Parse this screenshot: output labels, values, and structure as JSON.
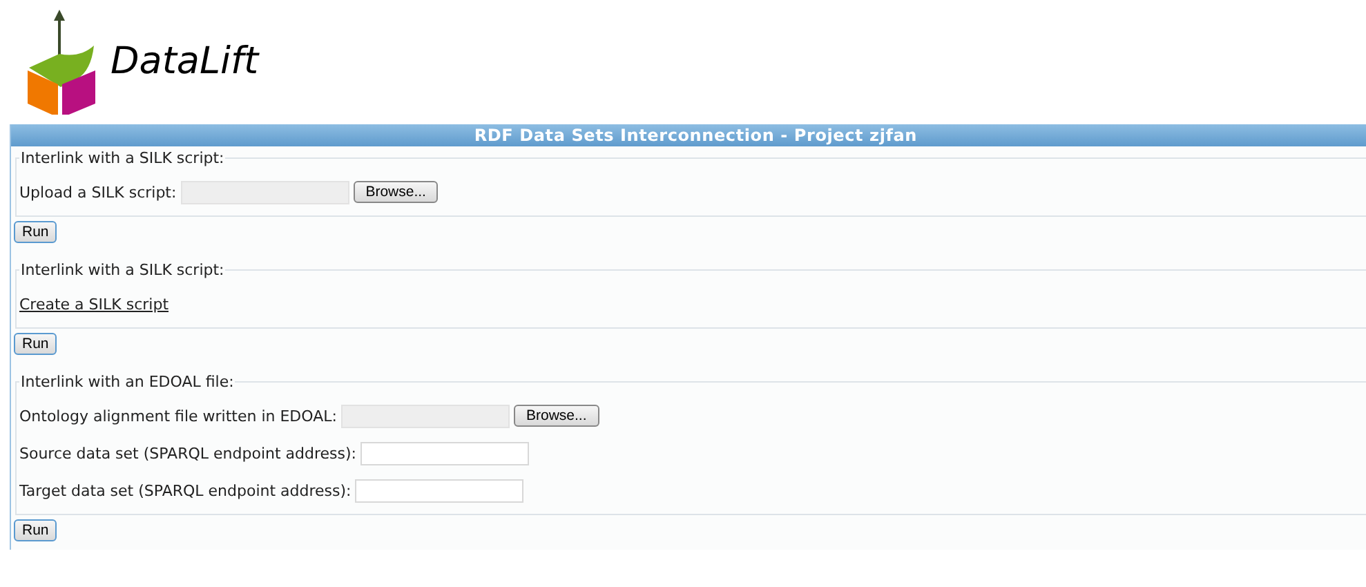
{
  "logo": {
    "text": "DataLift"
  },
  "header": {
    "title": "RDF Data Sets Interconnection - Project zjfan"
  },
  "sections": [
    {
      "legend": "Interlink with a SILK script:",
      "rows": [
        {
          "kind": "file",
          "label": "Upload a SILK script:",
          "button": "Browse..."
        }
      ],
      "run": "Run"
    },
    {
      "legend": "Interlink with a SILK script:",
      "rows": [
        {
          "kind": "link",
          "label": "Create a SILK script"
        }
      ],
      "run": "Run"
    },
    {
      "legend": "Interlink with an EDOAL file:",
      "rows": [
        {
          "kind": "file",
          "label": "Ontology alignment file written in EDOAL:",
          "button": "Browse..."
        },
        {
          "kind": "text",
          "label": "Source data set (SPARQL endpoint address):"
        },
        {
          "kind": "text",
          "label": "Target data set (SPARQL endpoint address):"
        }
      ],
      "run": "Run"
    }
  ]
}
